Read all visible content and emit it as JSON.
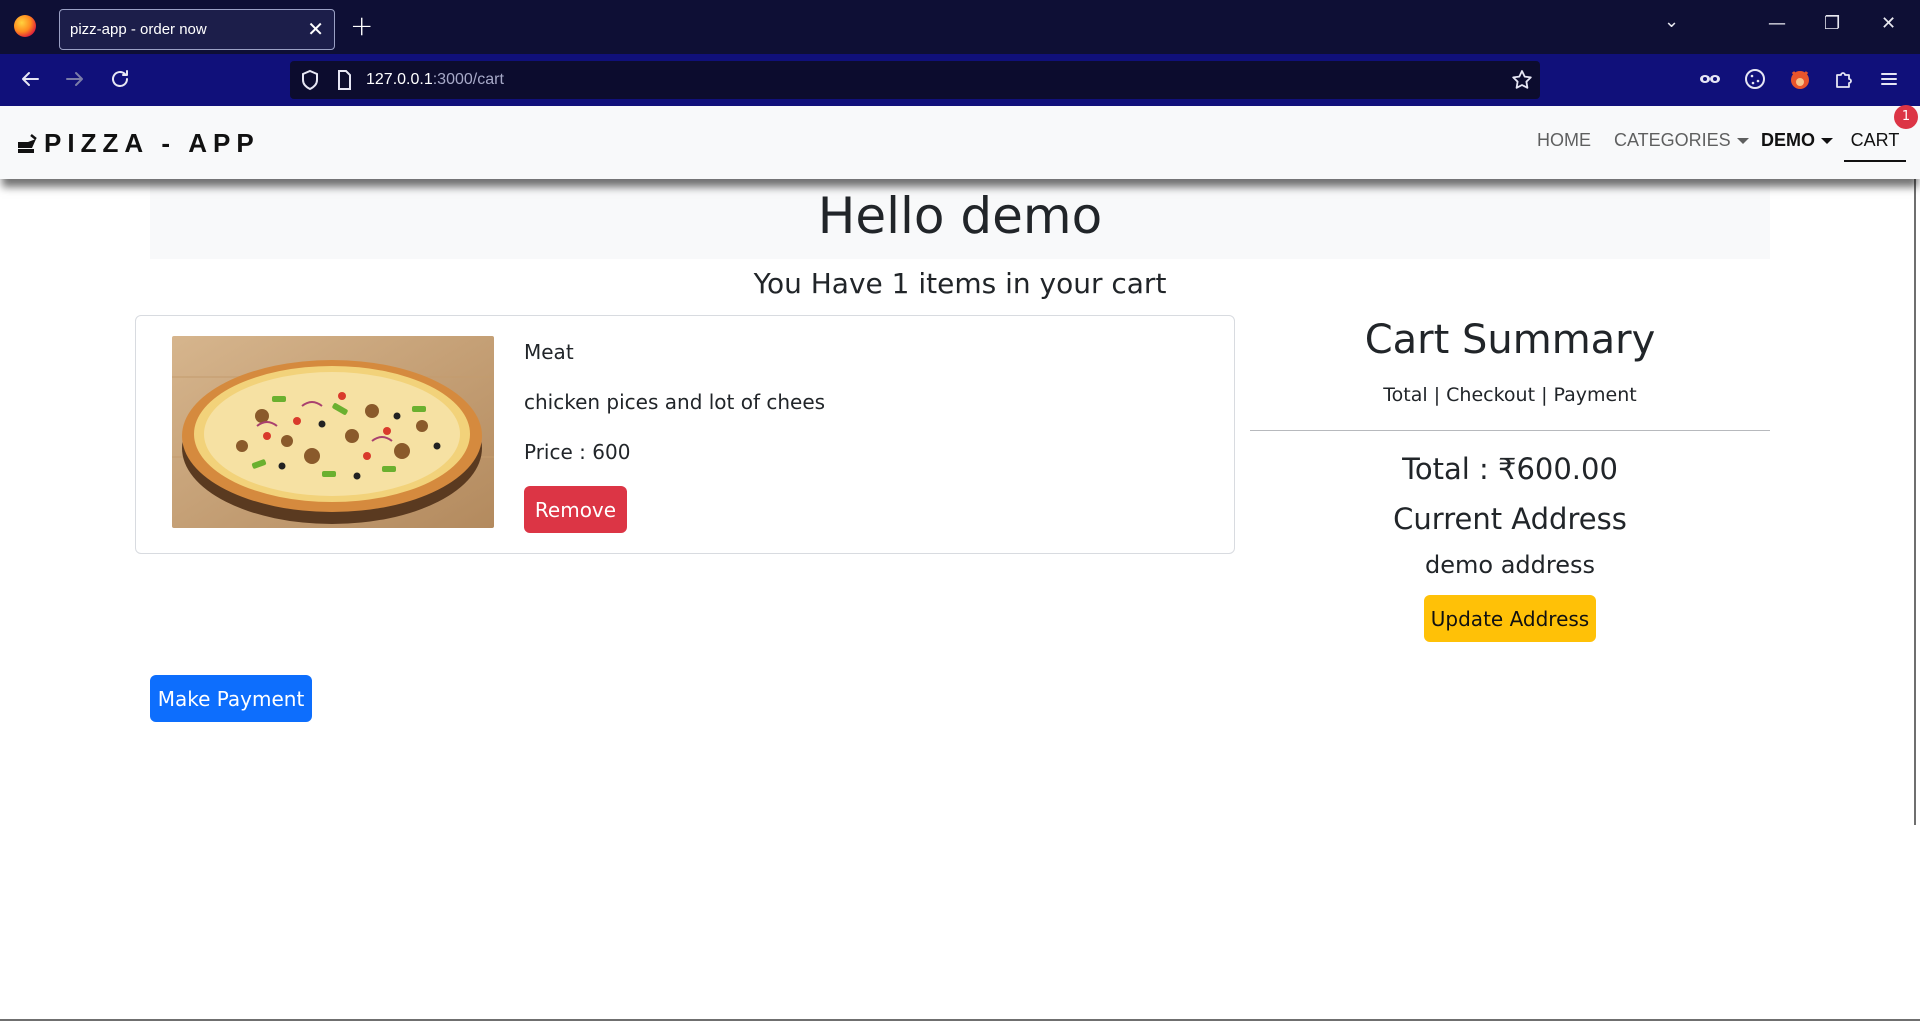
{
  "browser": {
    "tab_title": "pizz-app - order now",
    "tab_close": "✕",
    "new_tab": "+",
    "url_host": "127.0.0.1",
    "url_path": ":3000/cart",
    "controls": {
      "list_all_tabs": "⌄",
      "minimize": "—",
      "restore": "❐",
      "close": "✕"
    }
  },
  "site_nav": {
    "brand": "PIZZA - APP",
    "links": {
      "home": "HOME",
      "categories": "CATEGORIES",
      "user": "DEMO",
      "cart": "CART"
    },
    "cart_count": "1"
  },
  "page": {
    "greeting": "Hello demo",
    "cart_message": "You Have 1 items in your cart"
  },
  "cart_items": [
    {
      "name": "Meat",
      "description": "chicken pices and lot of chees",
      "price": "Price : 600",
      "remove_label": "Remove"
    }
  ],
  "summary": {
    "title": "Cart Summary",
    "subtitle": "Total | Checkout | Payment",
    "total": "Total : ₹600.00",
    "address_heading": "Current Address",
    "address": "demo address",
    "update_label": "Update Address"
  },
  "actions": {
    "pay_label": "Make Payment"
  },
  "colors": {
    "remove": "#dc3545",
    "update": "#ffc107",
    "pay": "#0d6efd",
    "badge": "#dc3545",
    "navbar_bg": "#f8f9fa"
  }
}
